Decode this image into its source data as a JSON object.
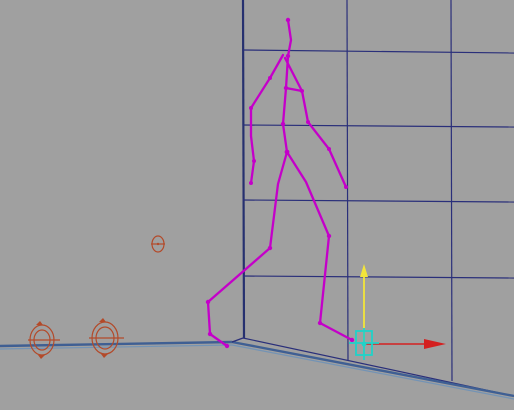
{
  "viewport": {
    "background": "#a0a0a0",
    "grid_color": "#2a2f7a",
    "floor_color": "#3f5f93",
    "skeleton_color": "#c400c9",
    "gizmo_x_color": "#d42020",
    "gizmo_y_color": "#f3e53a",
    "gizmo_z_color": "#20d2c8",
    "rotation_icon_color": "#b34a2a"
  }
}
